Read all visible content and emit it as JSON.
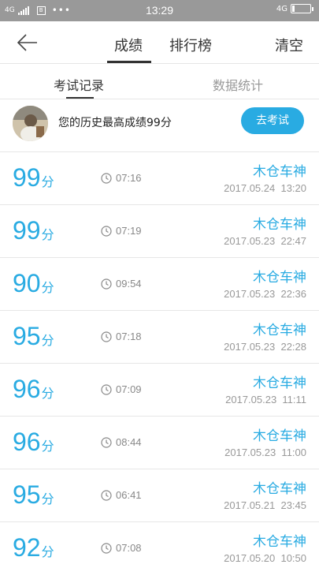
{
  "status_bar": {
    "network_left": "4G",
    "sim_badge": "B",
    "dots": "•••",
    "time": "13:29",
    "network_right": "4G"
  },
  "nav": {
    "tab_scores": "成绩",
    "tab_ranking": "排行榜",
    "clear_label": "清空"
  },
  "sub_tabs": {
    "records": "考试记录",
    "stats": "数据统计"
  },
  "best": {
    "text": "您的历史最高成绩99分",
    "exam_button": "去考试"
  },
  "score_unit": "分",
  "records": [
    {
      "score": "99",
      "duration": "07:16",
      "user": "木仓车神",
      "date": "2017.05.24  13:20"
    },
    {
      "score": "99",
      "duration": "07:19",
      "user": "木仓车神",
      "date": "2017.05.23  22:47"
    },
    {
      "score": "90",
      "duration": "09:54",
      "user": "木仓车神",
      "date": "2017.05.23  22:36"
    },
    {
      "score": "95",
      "duration": "07:18",
      "user": "木仓车神",
      "date": "2017.05.23  22:28"
    },
    {
      "score": "96",
      "duration": "07:09",
      "user": "木仓车神",
      "date": "2017.05.23  11:11"
    },
    {
      "score": "96",
      "duration": "08:44",
      "user": "木仓车神",
      "date": "2017.05.23  11:00"
    },
    {
      "score": "95",
      "duration": "06:41",
      "user": "木仓车神",
      "date": "2017.05.21  23:45"
    },
    {
      "score": "92",
      "duration": "07:08",
      "user": "木仓车神",
      "date": "2017.05.20  10:50"
    }
  ],
  "colors": {
    "accent": "#29abe2",
    "status_bar_bg": "#999999"
  },
  "icons": {
    "back": "arrow-left-icon",
    "duration": "clock-icon"
  }
}
